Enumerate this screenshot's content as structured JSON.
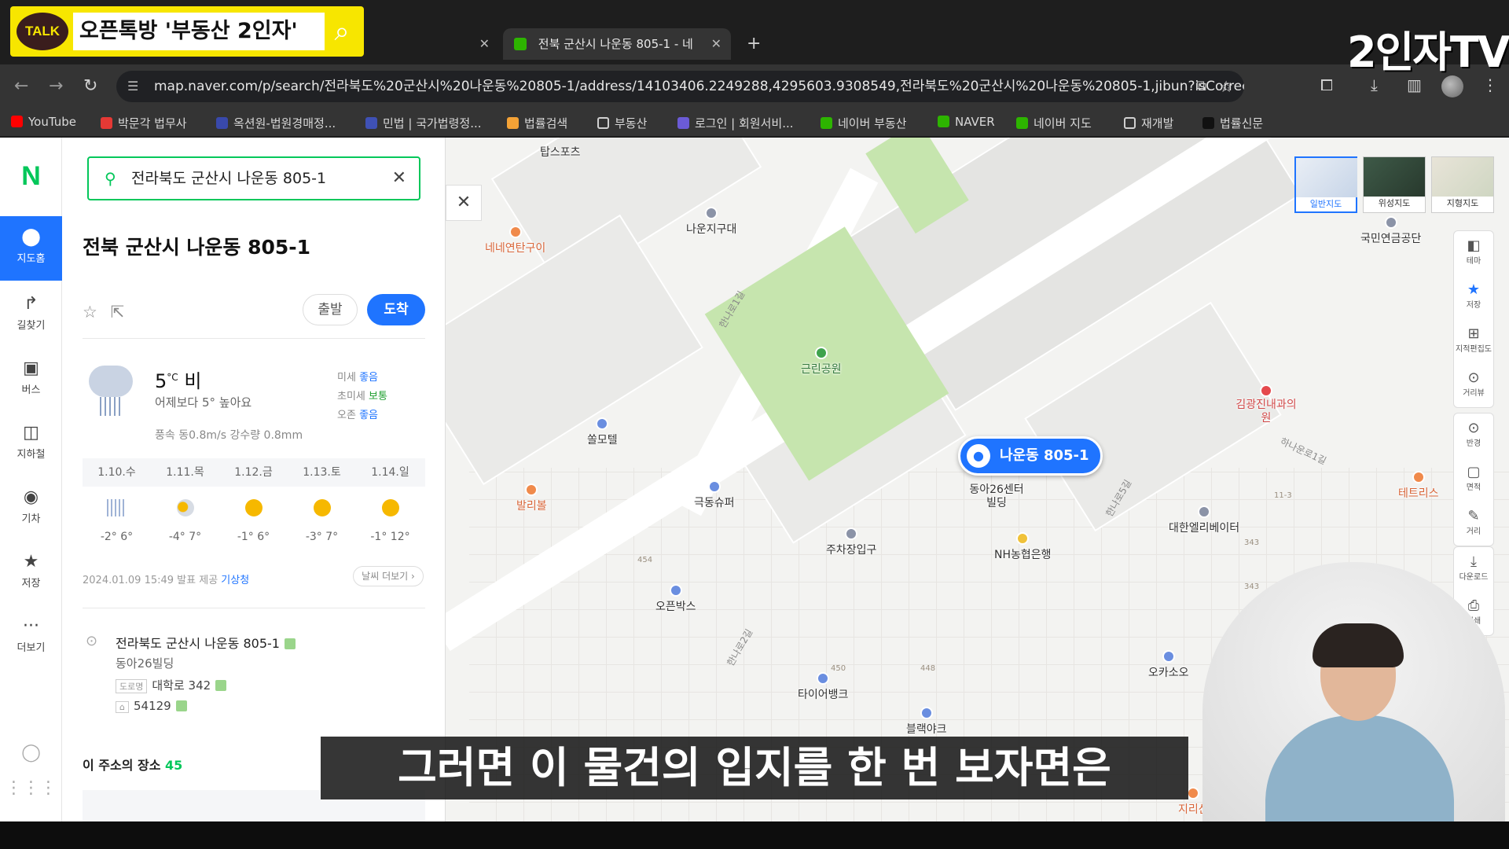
{
  "overlay": {
    "talk_badge": "TALK",
    "talk_text": "오픈톡방  '부동산 2인자'",
    "channel_logo": "2인자TV",
    "channel_sub": "2인자",
    "subtitle": "그러면 이 물건의 입지를 한 번 보자면은"
  },
  "browser": {
    "tabs": [
      {
        "label": ""
      },
      {
        "label": "전북 군산시 나운동 805-1 - 네"
      }
    ],
    "url": "map.naver.com/p/search/전라북도%20군산시%20나운동%20805-1/address/14103406.2249288,4295603.9308549,전라북도%20군산시%20나운동%20805-1,jibun?isCorrectAn...",
    "bookmarks": [
      {
        "label": "YouTube",
        "color": "#ff0000"
      },
      {
        "label": "박문각 법무사",
        "color": "#e53935"
      },
      {
        "label": "옥션원-법원경매정...",
        "color": "#3949ab"
      },
      {
        "label": "민법 | 국가법령정...",
        "color": "#3f51b5"
      },
      {
        "label": "법률검색",
        "color": "#f4a236"
      },
      {
        "label": "부동산",
        "color": "folder"
      },
      {
        "label": "로그인 | 회원서비...",
        "color": "#6b5bd6"
      },
      {
        "label": "네이버 부동산",
        "color": "#2db400"
      },
      {
        "label": "NAVER",
        "color": "#2db400"
      },
      {
        "label": "네이버 지도",
        "color": "#2db400"
      },
      {
        "label": "재개발",
        "color": "folder"
      },
      {
        "label": "법률신문",
        "color": "#111111"
      }
    ]
  },
  "rail": {
    "logo": "N",
    "items": [
      {
        "label": "지도홈",
        "icon": "map-pin-icon"
      },
      {
        "label": "길찾기",
        "icon": "directions-icon"
      },
      {
        "label": "버스",
        "icon": "bus-icon"
      },
      {
        "label": "지하철",
        "icon": "subway-icon"
      },
      {
        "label": "기차",
        "icon": "train-icon"
      },
      {
        "label": "저장",
        "icon": "star-icon"
      },
      {
        "label": "더보기",
        "icon": "more-icon"
      }
    ]
  },
  "panel": {
    "search_value": "전라북도 군산시 나운동 805-1",
    "title": "전북 군산시 나운동 805-1",
    "depart_label": "출발",
    "arrive_label": "도착",
    "weather": {
      "temp": "5",
      "unit": "°C",
      "condition": "비",
      "compare": "어제보다 5° 높아요",
      "dust_fine_label": "미세",
      "dust_fine_value": "좋음",
      "dust_ultra_label": "초미세",
      "dust_ultra_value": "보통",
      "ozone_label": "오존",
      "ozone_value": "좋음",
      "wind": "풍속 동0.8m/s 강수량 0.8mm",
      "forecast": [
        {
          "day": "1.10.수",
          "temp": "-2° 6°",
          "kind": "rain"
        },
        {
          "day": "1.11.목",
          "temp": "-4° 7°",
          "kind": "cloud"
        },
        {
          "day": "1.12.금",
          "temp": "-1° 6°",
          "kind": "sun"
        },
        {
          "day": "1.13.토",
          "temp": "-3° 7°",
          "kind": "sun"
        },
        {
          "day": "1.14.일",
          "temp": "-1° 12°",
          "kind": "sun"
        }
      ],
      "issued": "2024.01.09 15:49 발표",
      "provider_label": "제공",
      "provider": "기상청",
      "more": "날씨 더보기 ›"
    },
    "address": {
      "jibun": "전라북도 군산시 나운동 805-1",
      "building": "동아26빌딩",
      "road_tag": "도로명",
      "road": "대학로 342",
      "postcode": "54129"
    },
    "places_label": "이 주소의 장소",
    "places_count": "45"
  },
  "map": {
    "marker": "나운동 805-1",
    "layers": [
      "일반지도",
      "위성지도",
      "지형지도"
    ],
    "tools": [
      "테마",
      "저장",
      "지적편집도",
      "거리뷰",
      "반경",
      "면적",
      "거리",
      "다운로드",
      "인쇄"
    ],
    "pois": [
      {
        "name": "탑스포츠",
        "dot": "none"
      },
      {
        "name": "나운지구대",
        "dot": "gray"
      },
      {
        "name": "네네연탄구이",
        "dot": "orange"
      },
      {
        "name": "근린공원",
        "dot": "green"
      },
      {
        "name": "쏠모텔",
        "dot": "blue"
      },
      {
        "name": "발리볼",
        "dot": "orange"
      },
      {
        "name": "극동슈퍼",
        "dot": "blue"
      },
      {
        "name": "동아26센터빌딩",
        "dot": "none"
      },
      {
        "name": "주차장입구",
        "dot": "gray"
      },
      {
        "name": "NH농협은행",
        "dot": "yellow"
      },
      {
        "name": "오픈박스",
        "dot": "blue"
      },
      {
        "name": "대한엘리베이터",
        "dot": "gray"
      },
      {
        "name": "국민연금공단",
        "dot": "gray"
      },
      {
        "name": "김광진내과의원",
        "dot": "red"
      },
      {
        "name": "테트리스",
        "dot": "orange"
      },
      {
        "name": "오카소오",
        "dot": "blue"
      },
      {
        "name": "타이어뱅크",
        "dot": "blue"
      },
      {
        "name": "블랙야크",
        "dot": "blue"
      },
      {
        "name": "지리산",
        "dot": "orange"
      }
    ],
    "road_labels": [
      "한나로1길",
      "하나운로1길",
      "한나로2길",
      "한나로5길"
    ],
    "lot_numbers": [
      "454",
      "450",
      "448",
      "343",
      "343",
      "11-3"
    ]
  }
}
